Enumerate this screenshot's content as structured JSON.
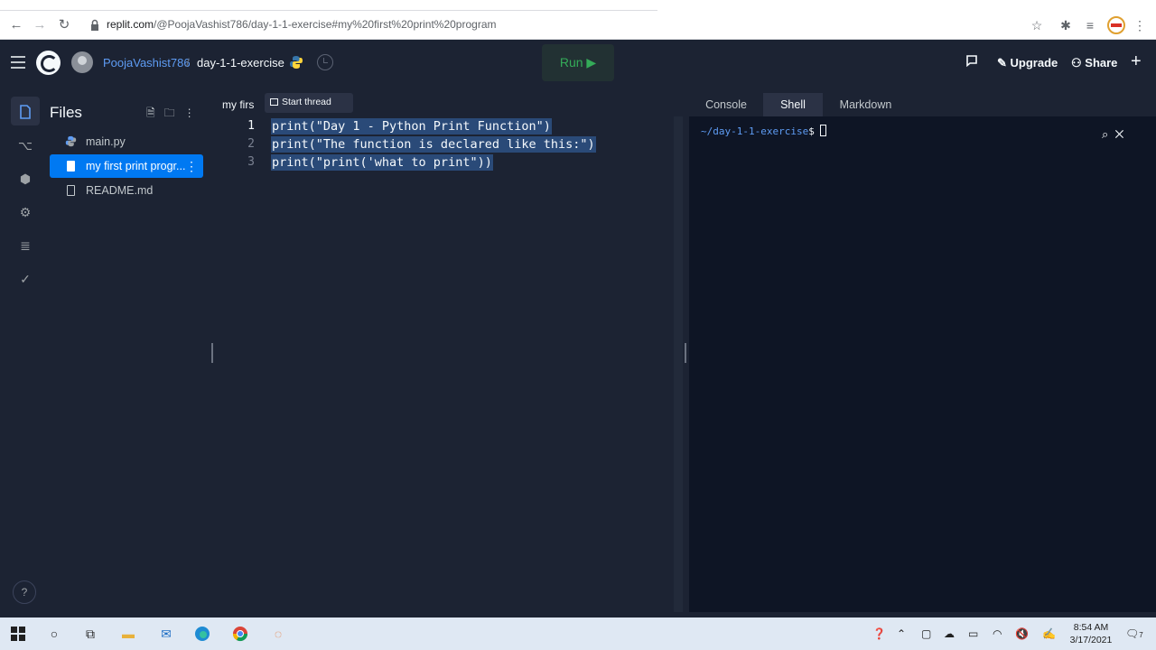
{
  "browser": {
    "url_host": "replit.com",
    "url_path": "/@PoojaVashist786/day-1-1-exercise#my%20first%20print%20program"
  },
  "header": {
    "username": "PoojaVashist786",
    "separator": "/",
    "repl_name": "day-1-1-exercise",
    "run_label": "Run ▶",
    "upgrade_label": "Upgrade",
    "share_label": "Share"
  },
  "files": {
    "title": "Files",
    "items": [
      {
        "name": "main.py",
        "icon": "python-icon"
      },
      {
        "name": "my first print progr...",
        "icon": "file-icon",
        "active": true
      },
      {
        "name": "README.md",
        "icon": "file-icon"
      }
    ]
  },
  "editor": {
    "tab_label": "my firs",
    "thread_tooltip": "Start thread",
    "lines": [
      {
        "number": "1",
        "text": "print(\"Day 1 - Python Print Function\")"
      },
      {
        "number": "2",
        "text": "print(\"The function is declared like this:\")"
      },
      {
        "number": "3",
        "text": "print(\"print('what to print\"))"
      }
    ]
  },
  "right_pane": {
    "tabs": [
      "Console",
      "Shell",
      "Markdown"
    ],
    "active_tab": "Shell",
    "prompt_path": "~/day-1-1-exercise",
    "prompt_symbol": "$"
  },
  "taskbar": {
    "time": "8:54 AM",
    "date": "3/17/2021",
    "notification_count": "7"
  },
  "colors": {
    "background": "#1c2333",
    "accent": "#0079f2",
    "run_green": "#34ab58",
    "link_blue": "#5e9cf4",
    "terminal_bg": "#0e1525"
  }
}
